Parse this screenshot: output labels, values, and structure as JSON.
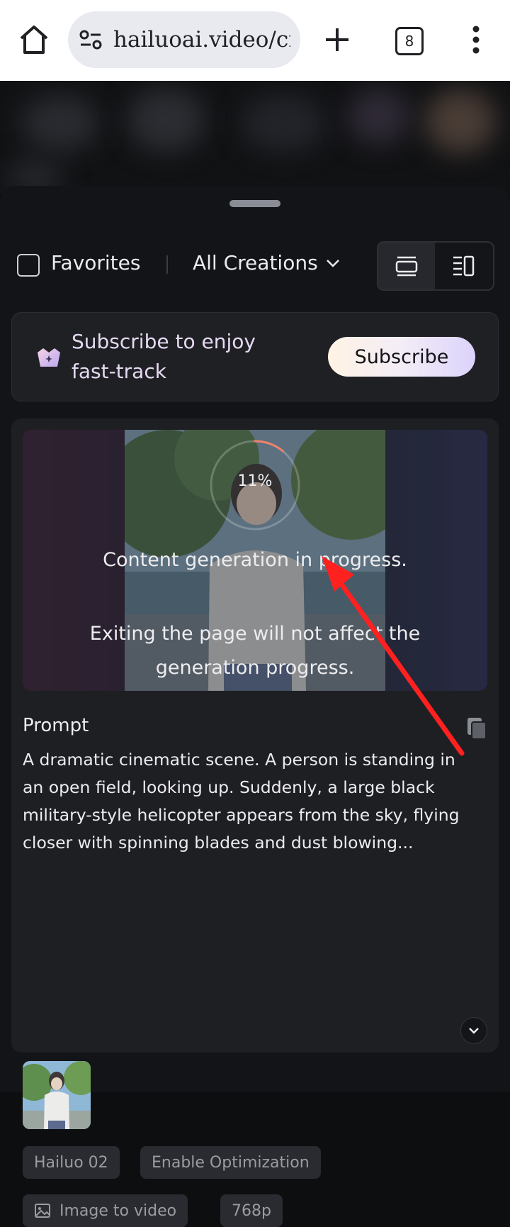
{
  "browser": {
    "url": "hailuoai.video/cre",
    "tab_count": "8"
  },
  "toolbar": {
    "favorites_label": "Favorites",
    "filter_label": "All Creations"
  },
  "subscribe_banner": {
    "text": "Subscribe to enjoy fast-track",
    "button_label": "Subscribe"
  },
  "generation": {
    "progress_label": "11%",
    "progress_fraction": 0.11,
    "status_text": "Content generation in progress.",
    "info_text": "Exiting the page will not affect the generation progress."
  },
  "prompt": {
    "title": "Prompt",
    "text": "A dramatic cinematic scene. A person is standing in an open field, looking up. Suddenly, a large black military-style helicopter appears from the sky, flying closer with spinning blades and dust blowing..."
  },
  "tags": {
    "model": "Hailuo 02",
    "optimization": "Enable Optimization",
    "mode": "Image to video",
    "resolution": "768p"
  },
  "icons": {
    "home": "home-icon",
    "site_info": "site-info-icon",
    "new_tab": "plus-icon",
    "menu": "more-vert-icon",
    "crown": "crown-icon",
    "copy": "copy-icon",
    "expand": "chevron-down-icon",
    "image": "image-icon"
  },
  "colors": {
    "annotation_arrow": "#ff2020",
    "progress_arc": "#f0826a"
  }
}
